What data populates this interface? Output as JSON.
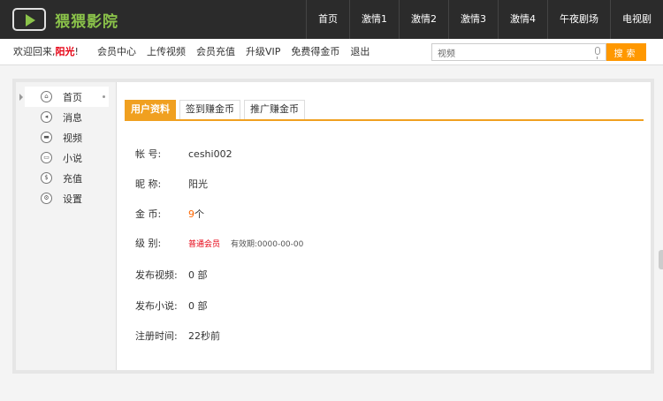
{
  "header": {
    "logo_text": "猥猥影院",
    "nav": [
      "首页",
      "激情1",
      "激情2",
      "激情3",
      "激情4",
      "午夜剧场",
      "电视剧"
    ]
  },
  "subbar": {
    "welcome_prefix": "欢迎回来,",
    "username": "阳光",
    "welcome_suffix": "!",
    "links": [
      "会员中心",
      "上传视频",
      "会员充值",
      "升级VIP",
      "免费得金币",
      "退出"
    ],
    "search_value": "视频",
    "search_button": "搜索"
  },
  "sidebar": {
    "items": [
      {
        "label": "首页",
        "icon": "home-icon",
        "glyph": "⌂"
      },
      {
        "label": "消息",
        "icon": "message-icon",
        "glyph": "◂"
      },
      {
        "label": "视频",
        "icon": "video-icon",
        "glyph": "▬"
      },
      {
        "label": "小说",
        "icon": "novel-icon",
        "glyph": "▭"
      },
      {
        "label": "充值",
        "icon": "recharge-icon",
        "glyph": "$"
      },
      {
        "label": "设置",
        "icon": "settings-icon",
        "glyph": "⚙"
      }
    ]
  },
  "tabs": [
    "用户资料",
    "签到赚金币",
    "推广赚金币"
  ],
  "profile": {
    "account_label": "帐      号:",
    "account_value": "ceshi002",
    "nickname_label": "昵      称:",
    "nickname_value": "阳光",
    "coins_label": "金      币:",
    "coins_value": "9",
    "coins_unit": " 个",
    "level_label": "级      别:",
    "level_value": "普通会员",
    "expiry": "有效期:0000-00-00",
    "videos_label": "发布视频:",
    "videos_value": "0 部",
    "novels_label": "发布小说:",
    "novels_value": "0 部",
    "regtime_label": "注册时间:",
    "regtime_value": "22秒前"
  },
  "colors": {
    "accent": "#f0a020",
    "search_button": "#ff9800",
    "logo": "#8bc34a",
    "highlight_red": "#e60012"
  }
}
